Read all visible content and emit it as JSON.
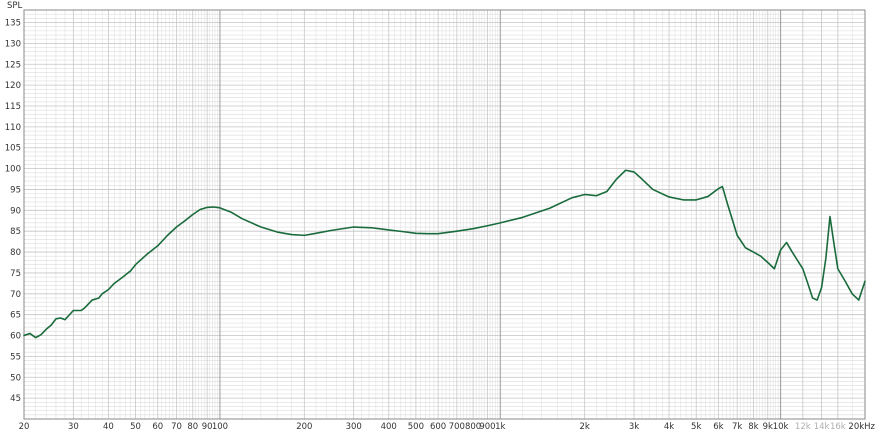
{
  "chart_data": {
    "type": "line",
    "title": "",
    "ylabel": "SPL",
    "xlabel": "",
    "x_unit_suffix": "Hz",
    "x_scale": "log",
    "xlim": [
      20,
      20000
    ],
    "ylim": [
      40,
      138
    ],
    "grid": true,
    "legend": "none",
    "colors": {
      "line": "#1a6b3c",
      "major_grid": "#9a9a9a",
      "minor_grid": "#dcdcdc",
      "frame": "#888888",
      "text": "#333333",
      "faded_tick": "#b0b0b0"
    },
    "y_ticks": [
      45,
      50,
      55,
      60,
      65,
      70,
      75,
      80,
      85,
      90,
      95,
      100,
      105,
      110,
      115,
      120,
      125,
      130,
      135
    ],
    "x_ticks": [
      {
        "value": 20,
        "label": "20"
      },
      {
        "value": 30,
        "label": "30"
      },
      {
        "value": 40,
        "label": "40"
      },
      {
        "value": 50,
        "label": "50"
      },
      {
        "value": 60,
        "label": "60"
      },
      {
        "value": 70,
        "label": "70"
      },
      {
        "value": 80,
        "label": "80"
      },
      {
        "value": 90,
        "label": "90"
      },
      {
        "value": 100,
        "label": "100"
      },
      {
        "value": 200,
        "label": "200"
      },
      {
        "value": 300,
        "label": "300"
      },
      {
        "value": 400,
        "label": "400"
      },
      {
        "value": 500,
        "label": "500"
      },
      {
        "value": 600,
        "label": "600"
      },
      {
        "value": 700,
        "label": "700"
      },
      {
        "value": 800,
        "label": "800"
      },
      {
        "value": 900,
        "label": "900"
      },
      {
        "value": 1000,
        "label": "1k"
      },
      {
        "value": 2000,
        "label": "2k"
      },
      {
        "value": 3000,
        "label": "3k"
      },
      {
        "value": 4000,
        "label": "4k"
      },
      {
        "value": 5000,
        "label": "5k"
      },
      {
        "value": 6000,
        "label": "6k"
      },
      {
        "value": 7000,
        "label": "7k"
      },
      {
        "value": 8000,
        "label": "8k"
      },
      {
        "value": 9000,
        "label": "9k"
      },
      {
        "value": 10000,
        "label": "10k"
      },
      {
        "value": 12000,
        "label": "12k",
        "faded": true
      },
      {
        "value": 14000,
        "label": "14k",
        "faded": true
      },
      {
        "value": 16000,
        "label": "16k",
        "faded": true
      },
      {
        "value": 20000,
        "label": "20kHz"
      }
    ],
    "series": [
      {
        "x": [
          20,
          21,
          22,
          23,
          24,
          25,
          26,
          27,
          28,
          30,
          32,
          33,
          35,
          37,
          38,
          40,
          42,
          45,
          48,
          50,
          55,
          60,
          65,
          70,
          75,
          80,
          85,
          90,
          95,
          100,
          110,
          120,
          140,
          160,
          180,
          200,
          220,
          250,
          300,
          350,
          400,
          450,
          500,
          550,
          600,
          700,
          800,
          900,
          1000,
          1200,
          1500,
          1800,
          2000,
          2200,
          2400,
          2600,
          2800,
          3000,
          3200,
          3500,
          4000,
          4500,
          5000,
          5500,
          6000,
          6200,
          6500,
          7000,
          7500,
          8000,
          8500,
          9000,
          9500,
          10000,
          10500,
          11000,
          12000,
          12500,
          13000,
          13500,
          14000,
          14500,
          15000,
          15500,
          16000,
          17000,
          18000,
          19000,
          20000
        ],
        "y": [
          60,
          60.5,
          59.5,
          60.2,
          61.5,
          62.5,
          64,
          64.2,
          63.8,
          66,
          66,
          66.7,
          68.5,
          69,
          70,
          71,
          72.5,
          74,
          75.5,
          77,
          79.5,
          81.5,
          84,
          86,
          87.5,
          89,
          90.2,
          90.7,
          90.8,
          90.6,
          89.5,
          88,
          86,
          84.8,
          84.2,
          84,
          84.5,
          85.2,
          86,
          85.8,
          85.3,
          84.9,
          84.5,
          84.4,
          84.4,
          85,
          85.6,
          86.3,
          87,
          88.3,
          90.5,
          93,
          93.8,
          93.5,
          94.5,
          97.5,
          99.6,
          99.2,
          97.5,
          95,
          93.2,
          92.5,
          92.5,
          93.3,
          95.2,
          95.7,
          91,
          84,
          81,
          80,
          79,
          77.5,
          76,
          80.5,
          82.3,
          80,
          76,
          72.5,
          69,
          68.5,
          71.5,
          78.5,
          88.5,
          82,
          76,
          73,
          70,
          68.5,
          73
        ]
      }
    ]
  }
}
